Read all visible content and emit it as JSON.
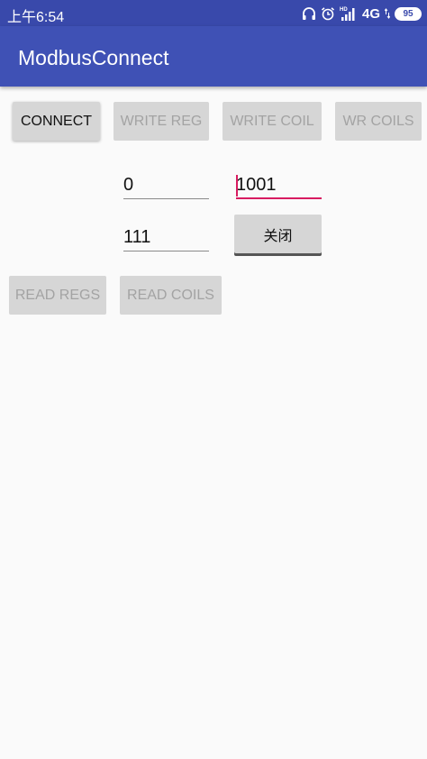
{
  "status_bar": {
    "time": "上午6:54",
    "network": "4G",
    "battery": "95"
  },
  "app_bar": {
    "title": "ModbusConnect"
  },
  "buttons": {
    "connect": "CONNECT",
    "write_reg": "WRITE REG",
    "write_coil": "WRITE COIL",
    "wr_coils": "WR COILS",
    "close": "关闭",
    "read_regs": "READ REGS",
    "read_coils": "READ COILS"
  },
  "fields": {
    "address": "0",
    "value": "1001",
    "count": "111"
  }
}
